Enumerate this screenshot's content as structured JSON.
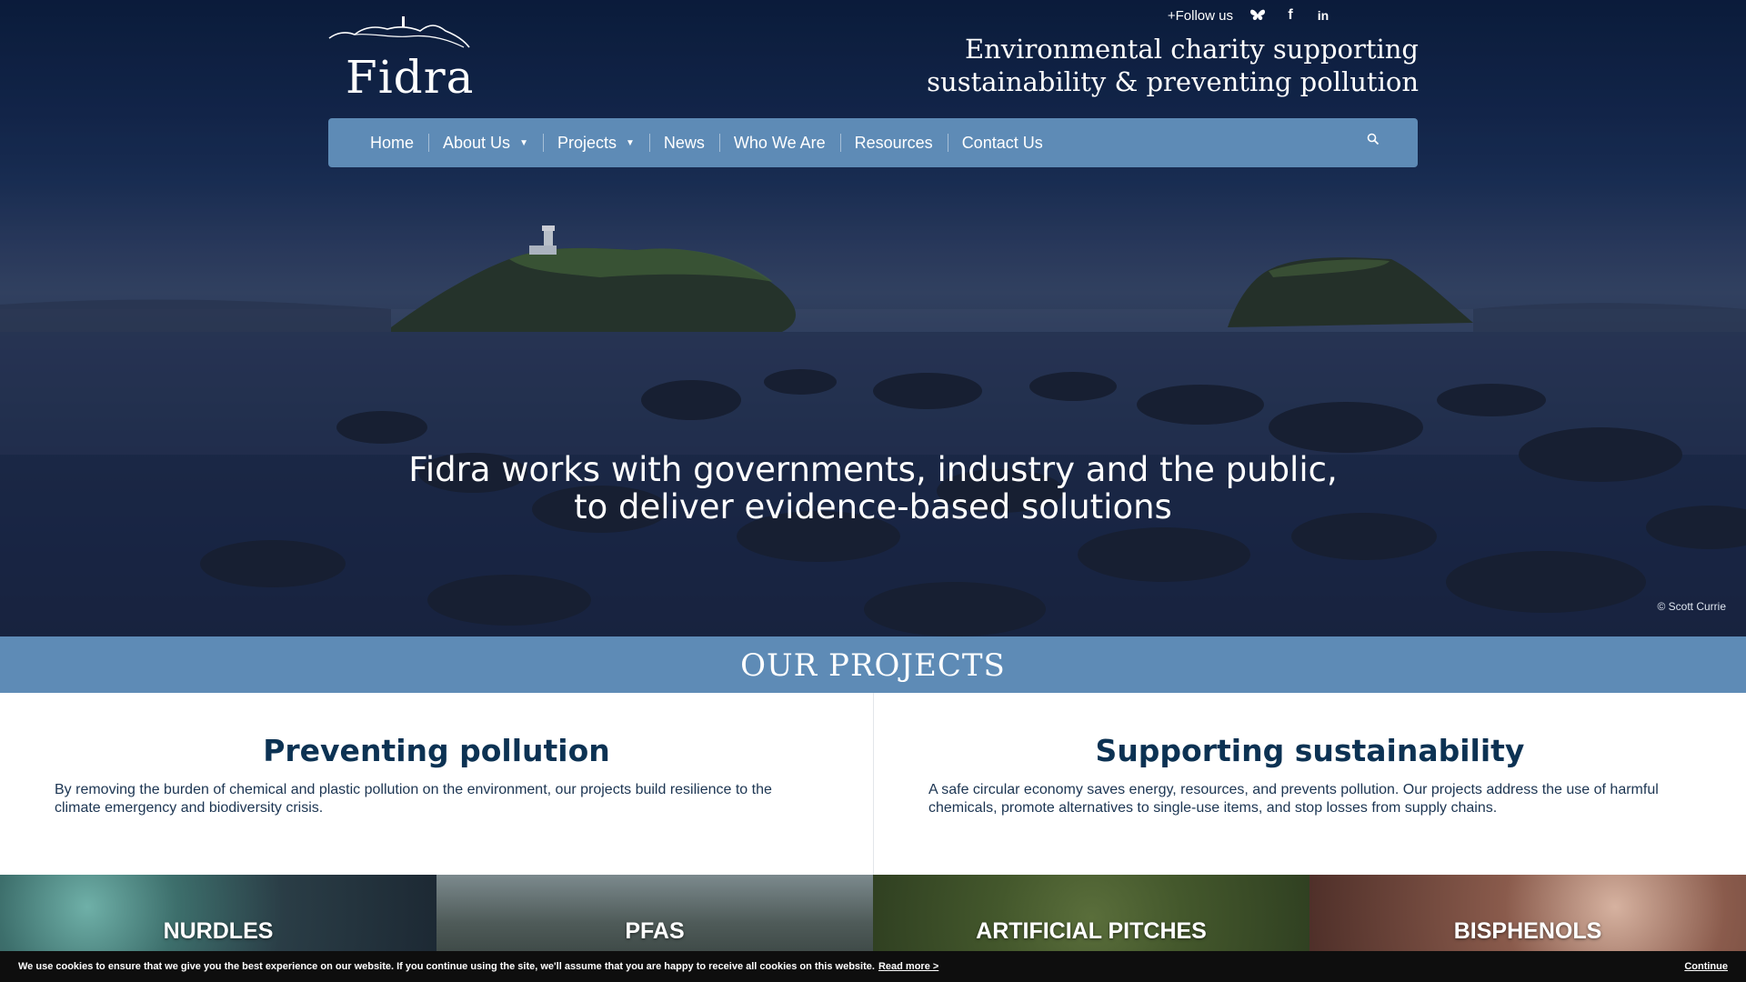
{
  "header": {
    "logo_text": "Fidra",
    "follow_label": "+Follow us",
    "social_icons": [
      "butterfly-icon",
      "facebook-icon",
      "linkedin-icon"
    ],
    "tagline_line1": "Environmental charity supporting",
    "tagline_line2": "sustainability & preventing pollution"
  },
  "nav": {
    "items": [
      {
        "label": "Home",
        "dropdown": false
      },
      {
        "label": "About Us",
        "dropdown": true
      },
      {
        "label": "Projects",
        "dropdown": true
      },
      {
        "label": "News",
        "dropdown": false
      },
      {
        "label": "Who We Are",
        "dropdown": false
      },
      {
        "label": "Resources",
        "dropdown": false
      },
      {
        "label": "Contact Us",
        "dropdown": false
      }
    ],
    "search_icon": "search-icon"
  },
  "hero": {
    "headline_line1": "Fidra works with governments, industry and the public,",
    "headline_line2": "to deliver evidence-based solutions",
    "credit": "© Scott Currie"
  },
  "projects": {
    "title": "OUR PROJECTS",
    "columns": [
      {
        "heading": "Preventing pollution",
        "text": "By removing the burden of chemical and plastic pollution on the environment, our projects build resilience to the climate emergency and biodiversity crisis."
      },
      {
        "heading": "Supporting sustainability",
        "text": "A safe circular economy saves energy, resources, and prevents pollution. Our projects address the use of harmful chemicals, promote alternatives to single-use items, and stop losses from supply chains."
      }
    ],
    "tiles": [
      "NURDLES",
      "PFAS",
      "ARTIFICIAL PITCHES",
      "BISPHENOLS"
    ]
  },
  "cookie": {
    "text": "We use cookies to ensure that we give you the best experience on our website. If you continue using the site, we'll assume that you are happy to receive all cookies on this website.",
    "read_more": "Read more >",
    "continue": "Continue"
  },
  "colors": {
    "nav_bg": "#5e8bb6",
    "heading_navy": "#0c3253",
    "cookie_bg": "#0e0e0e"
  }
}
